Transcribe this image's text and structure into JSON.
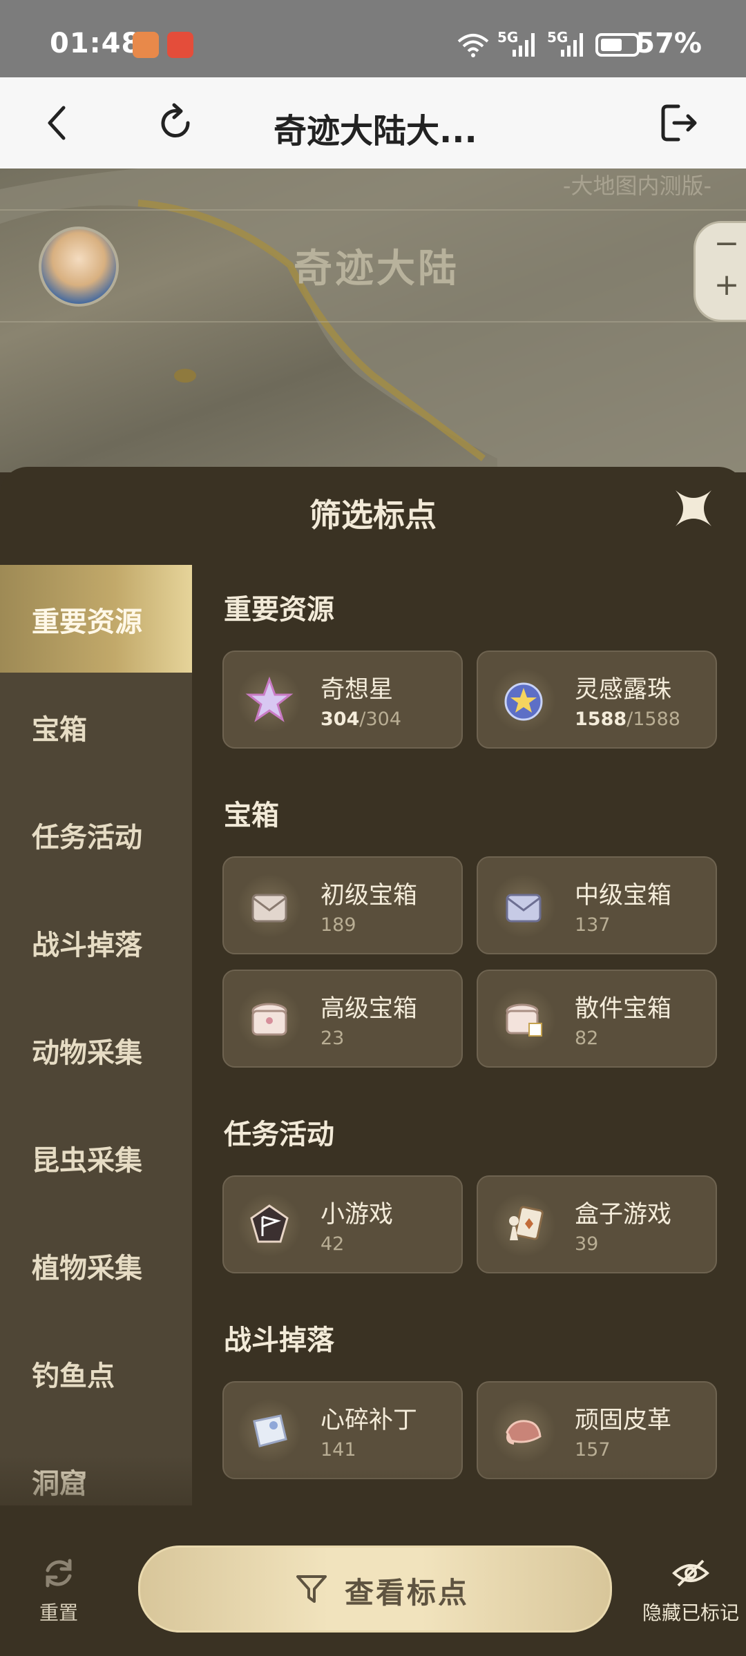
{
  "status_bar": {
    "time": "01:48",
    "battery": "57%",
    "network1": "5G",
    "network2": "5G"
  },
  "header": {
    "title": "奇迹大陆大...",
    "back_icon": "chevron-left-icon",
    "refresh_icon": "refresh-icon",
    "exit_icon": "exit-icon"
  },
  "map": {
    "title": "奇迹大陆",
    "subtitle": "-大地图内测版-",
    "zoom_out": "−",
    "zoom_in": "+"
  },
  "panel": {
    "title": "筛选标点",
    "sidebar": [
      {
        "label": "重要资源",
        "active": true
      },
      {
        "label": "宝箱"
      },
      {
        "label": "任务活动"
      },
      {
        "label": "战斗掉落"
      },
      {
        "label": "动物采集"
      },
      {
        "label": "昆虫采集"
      },
      {
        "label": "植物采集"
      },
      {
        "label": "钓鱼点"
      },
      {
        "label": "洞窟"
      }
    ],
    "sections": [
      {
        "title": "重要资源",
        "items": [
          {
            "name": "奇想星",
            "collected": "304",
            "total": "/304",
            "icon": "star-icon"
          },
          {
            "name": "灵感露珠",
            "collected": "1588",
            "total": "/1588",
            "icon": "dew-orb-icon"
          }
        ]
      },
      {
        "title": "宝箱",
        "items": [
          {
            "name": "初级宝箱",
            "count": "189",
            "icon": "chest-icon"
          },
          {
            "name": "中级宝箱",
            "count": "137",
            "icon": "chest-icon"
          },
          {
            "name": "高级宝箱",
            "count": "23",
            "icon": "chest-icon"
          },
          {
            "name": "散件宝箱",
            "count": "82",
            "icon": "chest-icon"
          }
        ]
      },
      {
        "title": "任务活动",
        "items": [
          {
            "name": "小游戏",
            "count": "42",
            "icon": "flag-icon"
          },
          {
            "name": "盒子游戏",
            "count": "39",
            "icon": "card-game-icon"
          }
        ]
      },
      {
        "title": "战斗掉落",
        "items": [
          {
            "name": "心碎补丁",
            "count": "141",
            "icon": "patch-icon"
          },
          {
            "name": "顽固皮革",
            "count": "157",
            "icon": "leather-icon"
          }
        ]
      }
    ]
  },
  "bottom_bar": {
    "reset_label": "重置",
    "view_label": "查看标点",
    "hide_label": "隐藏已标记"
  },
  "colors": {
    "panel_bg": "#3a3223",
    "sidebar_bg": "#4f4636",
    "card_bg": "#5a4f3c",
    "accent_gold": "#c2a96a"
  }
}
